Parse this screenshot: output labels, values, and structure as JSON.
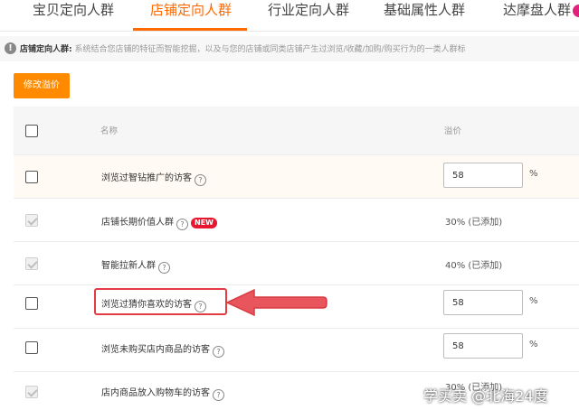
{
  "tabs": [
    {
      "label": "宝贝定向人群"
    },
    {
      "label": "店铺定向人群"
    },
    {
      "label": "行业定向人群"
    },
    {
      "label": "基础属性人群"
    },
    {
      "label": "达摩盘人群"
    }
  ],
  "notice": {
    "title": "店铺定向人群:",
    "text": "系统结合您店铺的特征而智能挖掘，以及与您的店铺或同类店铺产生过浏览/收藏/加购/购买行为的一类人群标"
  },
  "edit_button": "修改溢价",
  "table": {
    "headers": {
      "name": "名称",
      "price": "溢价"
    },
    "rows": [
      {
        "name": "浏览过智钻推广的访客",
        "value": "58",
        "unit": "%"
      },
      {
        "name": "店铺长期价值人群",
        "badge": "NEW",
        "status": "30% (已添加)"
      },
      {
        "name": "智能拉新人群",
        "status": "40% (已添加)"
      },
      {
        "name": "浏览过猜你喜欢的访客",
        "value": "58",
        "unit": "%"
      },
      {
        "name": "浏览未购买店内商品的访客",
        "value": "58",
        "unit": "%"
      },
      {
        "name": "店内商品放入购物车的访客",
        "status": "30% (已添加)"
      }
    ]
  },
  "help_glyph": "?",
  "watermark": "学买卖 @北海24度",
  "colors": {
    "accent": "#ff6a00",
    "button": "#ff8a00",
    "highlight": "#e43a44",
    "new_badge": "#e8162e"
  }
}
